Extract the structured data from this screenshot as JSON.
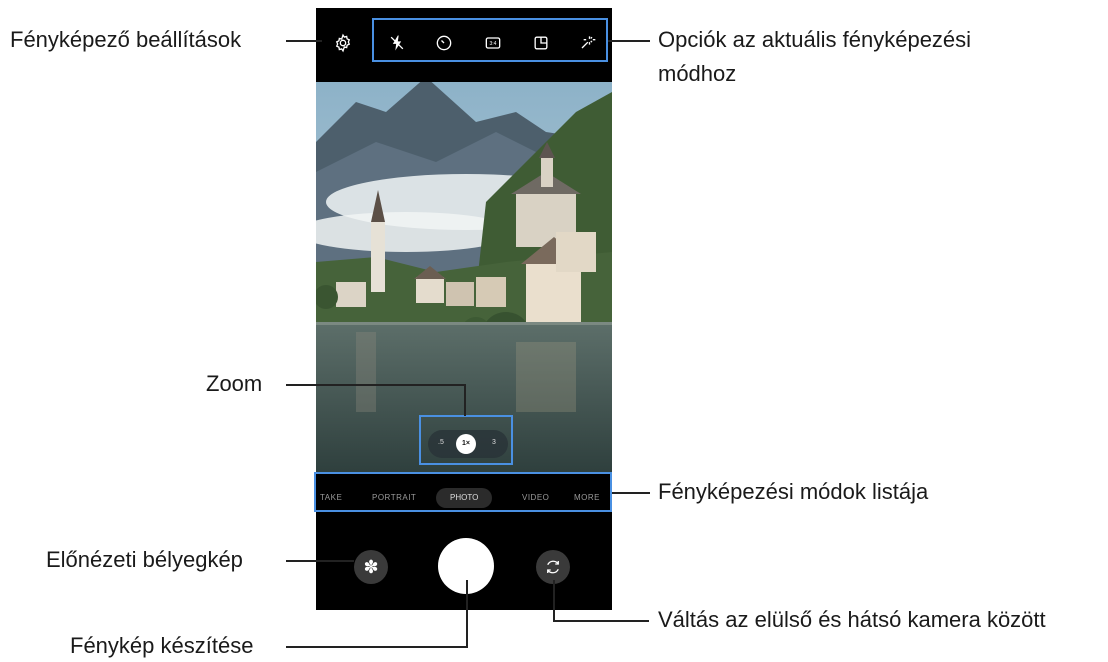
{
  "callouts": {
    "settings": "Fényképező beállítások",
    "options_line1": "Opciók az aktuális fényképezési",
    "options_line2": "módhoz",
    "zoom": "Zoom",
    "modes": "Fényképezési módok listája",
    "preview": "Előnézeti bélyegkép",
    "take_photo": "Fénykép készítése",
    "switch_camera": "Váltás az elülső és hátsó kamera között"
  },
  "top_icons": [
    "gear-icon",
    "flash-off-icon",
    "timer-icon",
    "aspect-ratio-icon",
    "motion-photo-icon",
    "filter-sparkle-icon"
  ],
  "modes": {
    "items": [
      "TAKE",
      "PORTRAIT",
      "PHOTO",
      "VIDEO",
      "MORE"
    ],
    "selected": "PHOTO"
  },
  "zoom": {
    "left": ".5",
    "selected": "1×",
    "right": "3"
  },
  "colors": {
    "highlight": "#4a90e2",
    "phone_bg": "#000000"
  }
}
